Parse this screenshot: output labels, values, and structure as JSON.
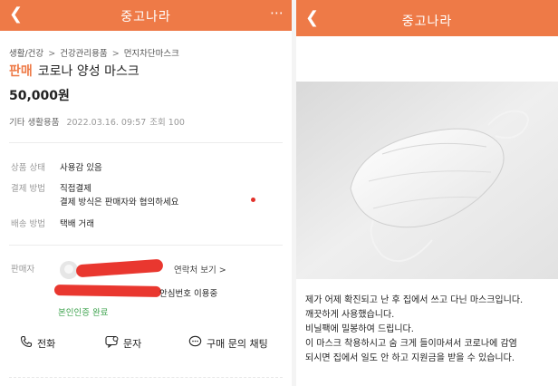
{
  "app_name": "중고나라",
  "left": {
    "breadcrumb": [
      "생활/건강",
      "건강관리용품",
      "먼지차단마스크"
    ],
    "sale_tag": "판매",
    "title": "코로나 양성 마스크",
    "price": "50,000원",
    "category": "기타 생활용품",
    "date": "2022.03.16. 09:57",
    "views": "조회 100",
    "info": [
      {
        "label": "상품 상태",
        "value": "사용감 있음"
      },
      {
        "label": "결제 방법",
        "value": "직접결제"
      },
      {
        "label": "",
        "value": "결제 방식은 판매자와 협의하세요"
      },
      {
        "label": "배송 방법",
        "value": "택배 거래"
      }
    ],
    "seller_label": "판매자",
    "contact_link": "연락처 보기 >",
    "safe_number": "안심번호 이용중",
    "verified": "본인인증 완료",
    "actions": [
      {
        "label": "전화",
        "icon": "phone-icon"
      },
      {
        "label": "문자",
        "icon": "sms-icon"
      },
      {
        "label": "구매 문의 채팅",
        "icon": "chat-icon"
      }
    ],
    "accent_color": "#ee7a47"
  },
  "right": {
    "photo_alt": "mask-photo",
    "description": [
      "제가 어제 확진되고 난 후 집에서 쓰고 다닌 마스크입니다.",
      "깨끗하게 사용했습니다.",
      "비닐팩에 밀봉하여 드립니다.",
      "이 마스크 착용하시고 숨 크게 들이마셔서 코로나에 감염",
      "되시면 집에서 일도 안 하고 지원금을 받을 수 있습니다."
    ]
  }
}
